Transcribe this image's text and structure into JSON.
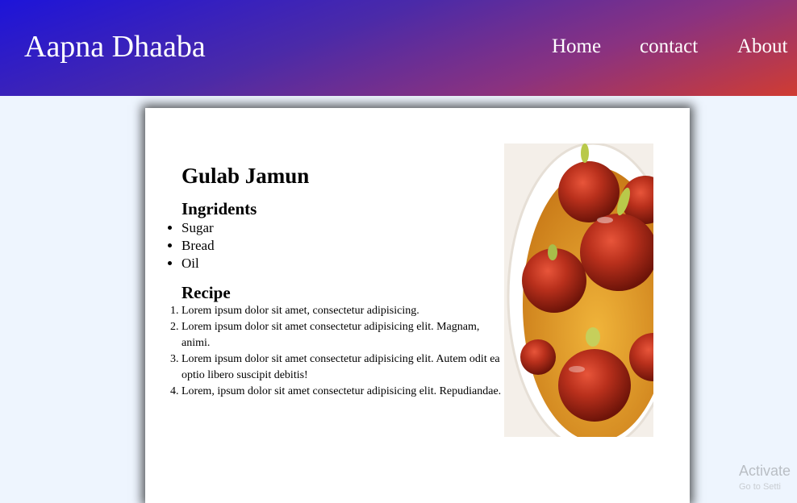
{
  "header": {
    "brand": "Aapna Dhaaba",
    "nav": [
      {
        "label": "Home"
      },
      {
        "label": "contact"
      },
      {
        "label": "About"
      }
    ]
  },
  "recipe_card": {
    "title": "Gulab Jamun",
    "ingredients_heading": "Ingridents",
    "ingredients": [
      "Sugar",
      "Bread",
      "Oil"
    ],
    "recipe_heading": "Recipe",
    "steps": [
      "Lorem ipsum dolor sit amet, consectetur adipisicing.",
      "Lorem ipsum dolor sit amet consectetur adipisicing elit. Magnam, animi.",
      "Lorem ipsum dolor sit amet consectetur adipisicing elit. Autem odit ea optio libero suscipit debitis!",
      "Lorem, ipsum dolor sit amet consectetur adipisicing elit. Repudiandae."
    ]
  },
  "overlay": {
    "watermark": "Activate",
    "watermark_sub": "Go to Setti"
  },
  "colors": {
    "header_gradient_start": "#1d14d9",
    "header_gradient_end": "#d03c32",
    "page_background": "#eef5fe",
    "card_background": "#ffffff"
  },
  "icons": {
    "photo": "gulab-jamun-photo"
  }
}
